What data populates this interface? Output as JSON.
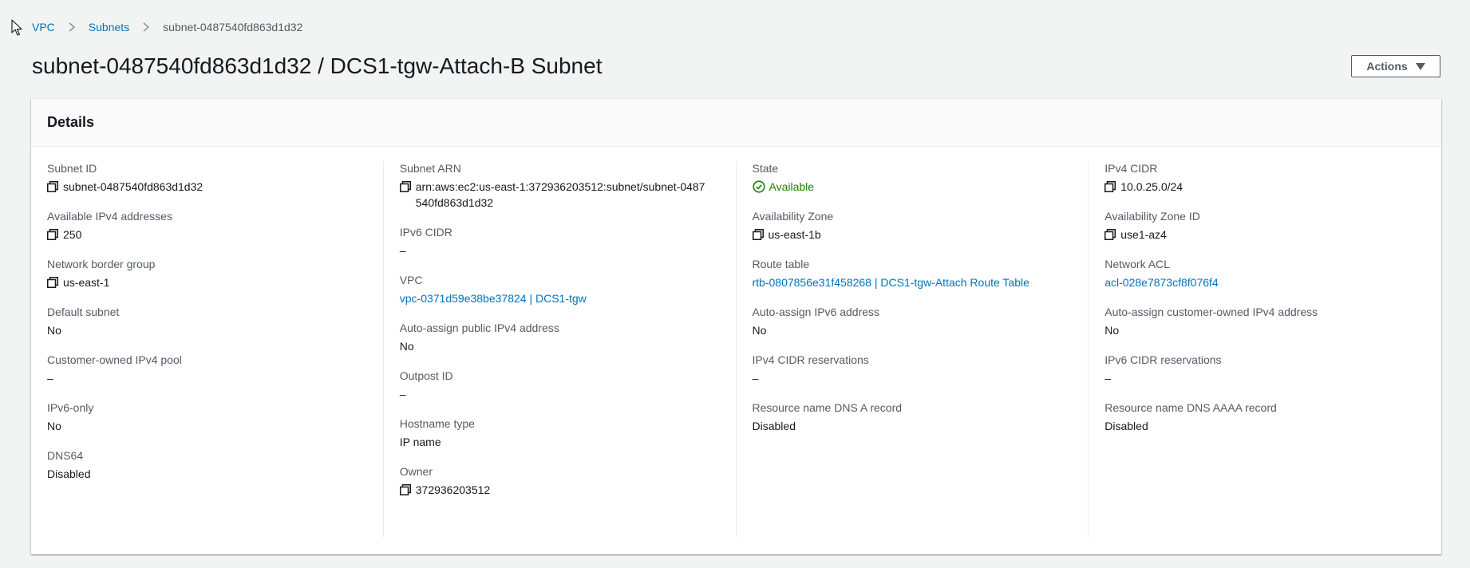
{
  "breadcrumb": {
    "items": [
      {
        "label": "VPC"
      },
      {
        "label": "Subnets"
      },
      {
        "label": "subnet-0487540fd863d1d32"
      }
    ]
  },
  "header": {
    "title": "subnet-0487540fd863d1d32 / DCS1-tgw-Attach-B Subnet",
    "actions_label": "Actions"
  },
  "details": {
    "title": "Details",
    "col1": {
      "subnet_id": {
        "label": "Subnet ID",
        "value": "subnet-0487540fd863d1d32"
      },
      "available_ipv4": {
        "label": "Available IPv4 addresses",
        "value": "250"
      },
      "network_border_group": {
        "label": "Network border group",
        "value": "us-east-1"
      },
      "default_subnet": {
        "label": "Default subnet",
        "value": "No"
      },
      "customer_owned_pool": {
        "label": "Customer-owned IPv4 pool",
        "value": "–"
      },
      "ipv6_only": {
        "label": "IPv6-only",
        "value": "No"
      },
      "dns64": {
        "label": "DNS64",
        "value": "Disabled"
      }
    },
    "col2": {
      "subnet_arn": {
        "label": "Subnet ARN",
        "value": "arn:aws:ec2:us-east-1:372936203512:subnet/subnet-0487540fd863d1d32"
      },
      "ipv6_cidr": {
        "label": "IPv6 CIDR",
        "value": "–"
      },
      "vpc": {
        "label": "VPC",
        "value": "vpc-0371d59e38be37824 | DCS1-tgw"
      },
      "auto_assign_public_ipv4": {
        "label": "Auto-assign public IPv4 address",
        "value": "No"
      },
      "outpost_id": {
        "label": "Outpost ID",
        "value": "–"
      },
      "hostname_type": {
        "label": "Hostname type",
        "value": "IP name"
      },
      "owner": {
        "label": "Owner",
        "value": "372936203512"
      }
    },
    "col3": {
      "state": {
        "label": "State",
        "value": "Available"
      },
      "availability_zone": {
        "label": "Availability Zone",
        "value": "us-east-1b"
      },
      "route_table": {
        "label": "Route table",
        "value": "rtb-0807856e31f458268 | DCS1-tgw-Attach Route Table"
      },
      "auto_assign_ipv6": {
        "label": "Auto-assign IPv6 address",
        "value": "No"
      },
      "ipv4_cidr_reservations": {
        "label": "IPv4 CIDR reservations",
        "value": "–"
      },
      "dns_a_record": {
        "label": "Resource name DNS A record",
        "value": "Disabled"
      }
    },
    "col4": {
      "ipv4_cidr": {
        "label": "IPv4 CIDR",
        "value": "10.0.25.0/24"
      },
      "availability_zone_id": {
        "label": "Availability Zone ID",
        "value": "use1-az4"
      },
      "network_acl": {
        "label": "Network ACL",
        "value": "acl-028e7873cf8f076f4"
      },
      "auto_assign_customer_owned": {
        "label": "Auto-assign customer-owned IPv4 address",
        "value": "No"
      },
      "ipv6_cidr_reservations": {
        "label": "IPv6 CIDR reservations",
        "value": "–"
      },
      "dns_aaaa_record": {
        "label": "Resource name DNS AAAA record",
        "value": "Disabled"
      }
    }
  },
  "colors": {
    "link": "#0073bb",
    "status_success": "#1d8102",
    "label": "#545b64",
    "text": "#16191f",
    "background": "#f2f3f3"
  },
  "icons": {
    "copy": "copy-icon",
    "status": "status-positive-icon",
    "breadcrumb_separator": "chevron-right-icon",
    "dropdown": "caret-down-icon"
  }
}
